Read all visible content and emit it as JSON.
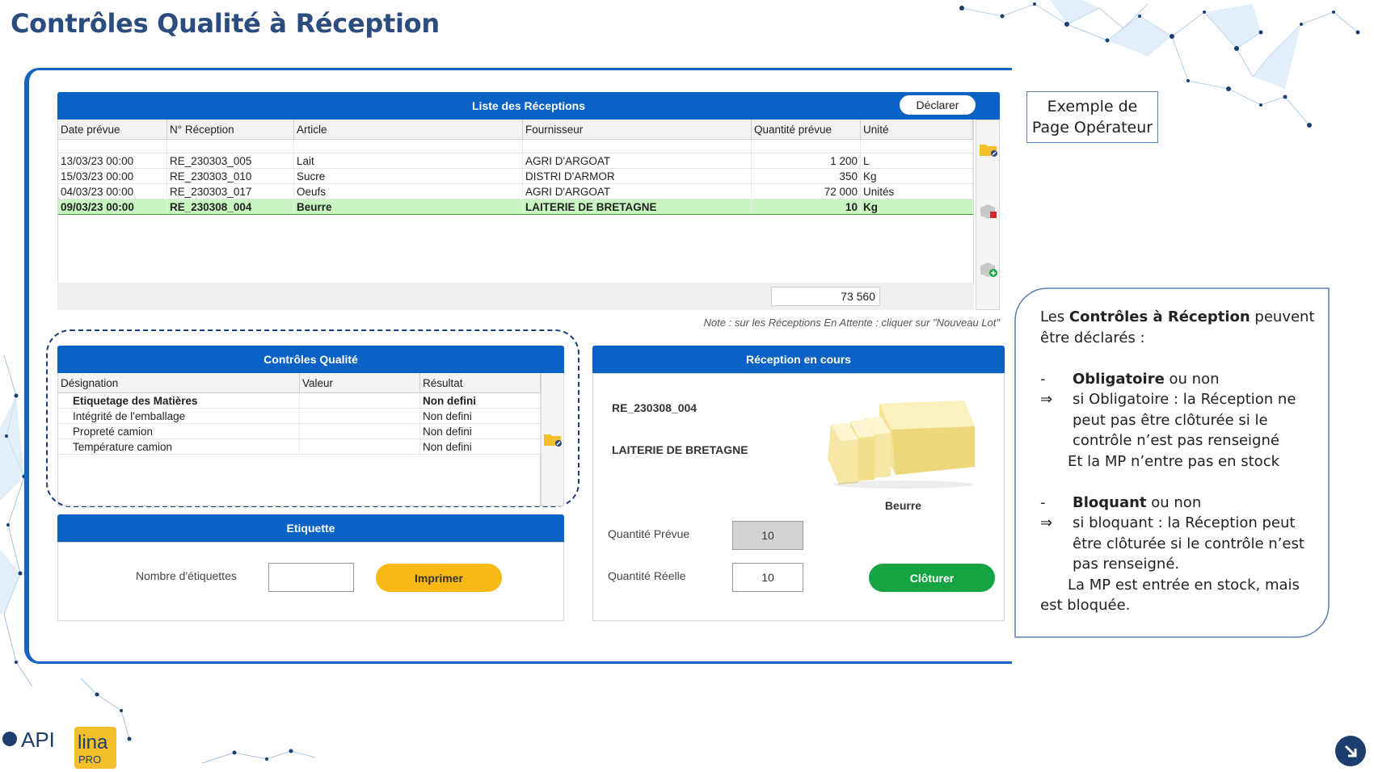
{
  "slide": {
    "title": "Contrôles Qualité à Réception"
  },
  "receptions": {
    "header": "Liste des Réceptions",
    "declare_label": "Déclarer",
    "columns": [
      "Date prévue",
      "N° Réception",
      "Article",
      "Fournisseur",
      "Quantité prévue",
      "Unité"
    ],
    "rows": [
      {
        "date": "13/03/23 00:00",
        "num": "RE_230303_005",
        "article": "Lait",
        "supplier": "AGRI D'ARGOAT",
        "qty": "1 200",
        "unit": "L"
      },
      {
        "date": "15/03/23 00:00",
        "num": "RE_230303_010",
        "article": "Sucre",
        "supplier": "DISTRI D'ARMOR",
        "qty": "350",
        "unit": "Kg"
      },
      {
        "date": "04/03/23 00:00",
        "num": "RE_230303_017",
        "article": "Oeufs",
        "supplier": "AGRI D'ARGOAT",
        "qty": "72 000",
        "unit": "Unités"
      },
      {
        "date": "09/03/23 00:00",
        "num": "RE_230308_004",
        "article": "Beurre",
        "supplier": "LAITERIE DE BRETAGNE",
        "qty": "10",
        "unit": "Kg"
      }
    ],
    "total": "73 560",
    "note": "Note : sur les Réceptions En Attente : cliquer sur \"Nouveau Lot\"",
    "tool_icons": [
      "folder-edit-icon",
      "box-delete-icon",
      "box-add-icon"
    ]
  },
  "quality": {
    "header": "Contrôles Qualité",
    "columns": [
      "Désignation",
      "Valeur",
      "Résultat"
    ],
    "rows": [
      {
        "name": "Etiquetage des Matières",
        "value": "",
        "result": "Non defini"
      },
      {
        "name": "Intégrité de l'emballage",
        "value": "",
        "result": "Non defini"
      },
      {
        "name": "Propreté camion",
        "value": "",
        "result": "Non defini"
      },
      {
        "name": "Température camion",
        "value": "",
        "result": "Non defini"
      }
    ]
  },
  "etiquette": {
    "header": "Etiquette",
    "count_label": "Nombre d'étiquettes",
    "count_value": "",
    "print_label": "Imprimer"
  },
  "current_reception": {
    "header": "Réception en cours",
    "number": "RE_230308_004",
    "supplier": "LAITERIE DE BRETAGNE",
    "article": "Beurre",
    "planned_label": "Quantité Prévue",
    "planned_value": "10",
    "real_label": "Quantité Réelle",
    "real_value": "10",
    "close_label": "Clôturer"
  },
  "example": {
    "line1": "Exemple de",
    "line2": "Page Opérateur"
  },
  "info": {
    "intro_pre": "Les ",
    "intro_bold": "Contrôles à Réception",
    "intro_post": " peuvent",
    "intro_line2": "être déclarés :",
    "dash": "-",
    "arrow": "⇒",
    "mandatory_bold": "Obligatoire",
    "mandatory_post": " ou non",
    "mandatory_l1": "si Obligatoire : la Réception ne",
    "mandatory_l2": "peut pas être clôturée si le",
    "mandatory_l3": "contrôle n’est pas renseigné",
    "mandatory_l4": "Et la MP n’entre pas en stock",
    "blocking_bold": "Bloquant",
    "blocking_post": " ou non",
    "blocking_l1": "si bloquant : la Réception peut",
    "blocking_l2": "être clôturée si le contrôle n’est",
    "blocking_l3": "pas renseigné.",
    "blocking_l4": "La MP est entrée en stock, mais",
    "blocking_l5": "est bloquée."
  },
  "logos": {
    "api": "API",
    "lina": "lina",
    "pro": "PRO"
  },
  "colors": {
    "primary": "#0a63c4",
    "title": "#2b4c7e",
    "print": "#f9b813",
    "close": "#16a442",
    "selected_row": "#c8f5c0"
  }
}
